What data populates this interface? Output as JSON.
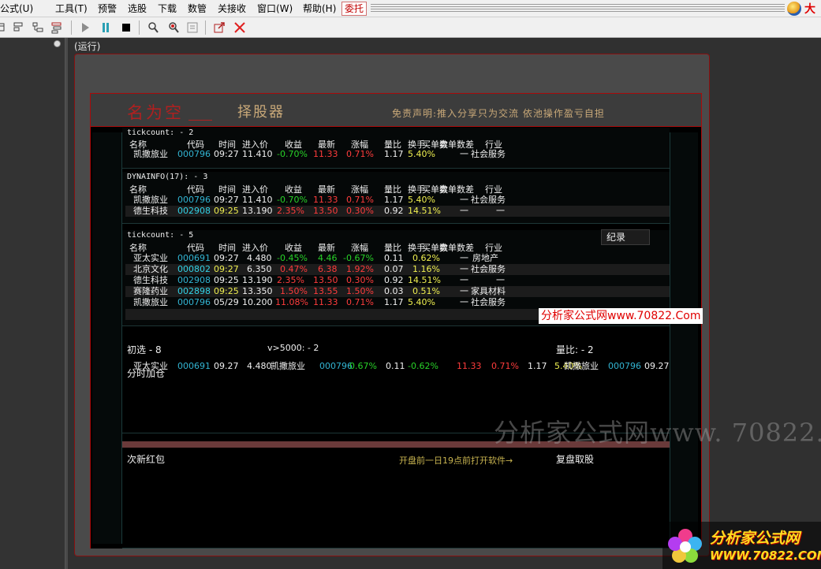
{
  "menu": {
    "items": [
      "公式(U)",
      "工具(T)",
      "预警",
      "选股",
      "下载",
      "数管",
      "关接收",
      "窗口(W)",
      "帮助(H)"
    ],
    "entrust": "委托",
    "brand": "大"
  },
  "toolbar": {
    "icons": [
      "window-layout-icon",
      "tile-layout-icon",
      "tree-layout-icon",
      "list-layout-icon",
      "run-icon",
      "pause-icon",
      "stop-icon",
      "search-icon",
      "search-red-icon",
      "formula-icon",
      "export-icon",
      "close-icon"
    ]
  },
  "panel": {
    "run_label": "(运行)"
  },
  "header": {
    "brand_name": "名为空",
    "title": "择股器",
    "disclaimer": "免责声明:推入分享只为交流 依池操作盈亏自担"
  },
  "columns": [
    "名称",
    "代码",
    "时间",
    "进入价",
    "收益",
    "最新",
    "涨幅",
    "量比",
    "换手",
    "买单数",
    "卖单数差",
    "行业"
  ],
  "sections": [
    {
      "title": "tickcount: - 2",
      "rows": [
        [
          "凯撒旅业",
          "000796",
          "09:27",
          "11.410",
          "-0.70%",
          "11.33",
          "0.71%",
          "1.17",
          "5.40%",
          "一",
          "社会服务"
        ]
      ]
    },
    {
      "title": "DYNAINFO(17): - 3",
      "rows": [
        [
          "凯撒旅业",
          "000796",
          "09:27",
          "11.410",
          "-0.70%",
          "11.33",
          "0.71%",
          "1.17",
          "5.40%",
          "一",
          "社会服务"
        ],
        [
          "德生科技",
          "002908",
          "09:25",
          "13.190",
          "2.35%",
          "13.50",
          "0.30%",
          "0.92",
          "14.51%",
          "一",
          "一"
        ]
      ]
    },
    {
      "title": "tickcount: - 5",
      "rows": [
        [
          "亚太实业",
          "000691",
          "09:27",
          "4.480",
          "-0.45%",
          "4.46",
          "-0.67%",
          "0.11",
          "0.62%",
          "一",
          "房地产"
        ],
        [
          "北京文化",
          "000802",
          "09:27",
          "6.350",
          "0.47%",
          "6.38",
          "1.92%",
          "0.07",
          "1.16%",
          "一",
          "社会服务"
        ],
        [
          "德生科技",
          "002908",
          "09:25",
          "13.190",
          "2.35%",
          "13.50",
          "0.30%",
          "0.92",
          "14.51%",
          "一",
          "一"
        ],
        [
          "赛隆药业",
          "002898",
          "09:25",
          "13.350",
          "1.50%",
          "13.55",
          "1.50%",
          "0.03",
          "0.51%",
          "一",
          "家具材料"
        ],
        [
          "凯撒旅业",
          "000796",
          "05/29",
          "10.200",
          "11.08%",
          "11.33",
          "0.71%",
          "1.17",
          "5.40%",
          "一",
          "社会服务"
        ]
      ]
    }
  ],
  "bottom": {
    "left_title": "初选 - 8",
    "mid_title": "v>5000: - 2",
    "right_title": "量比: - 2",
    "row_name": "亚太实业",
    "row_code": "000691",
    "row_time": "09.27",
    "row_price": "4.480",
    "mid_row_name": "凯撒旅业",
    "mid_row_code": "000796",
    "mid_row_price": "0.67%",
    "mid_row_c4": "0.11",
    "mid_row_c5": "-0.62%",
    "mid_row_c6": "11.33",
    "mid_row_c7": "0.71%",
    "mid_row_c8": "1.17",
    "mid_row_c9": "5.40%",
    "right_row_name": "凯撒旅业",
    "right_row_code": "000796",
    "right_row_time": "09.27",
    "add_position": "分时加仓",
    "new_red": "次新红包",
    "open_hint": "开盘前一日19点前打开软件→",
    "review": "复盘取股"
  },
  "record_button": "纪录",
  "watermarks": {
    "small": "分析家公式网www.70822.Com",
    "big": "分析家公式网www. 70822.",
    "logo": "分析家公式网",
    "logo_url": "WWW.70822.COM"
  }
}
